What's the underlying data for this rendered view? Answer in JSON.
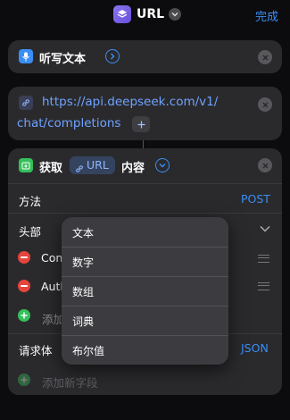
{
  "topbar": {
    "title": "URL",
    "done_label": "完成"
  },
  "dictate_action": {
    "label": "听写文本"
  },
  "url_action": {
    "url_line1": "https://api.deepseek.com/v1/",
    "url_line2": "chat/completions"
  },
  "get_contents": {
    "verb": "获取",
    "token": "URL",
    "suffix": "内容",
    "method_label": "方法",
    "method_value": "POST",
    "headers_label": "头部",
    "header1_key": "Con",
    "header2_key": "Auth",
    "add_header_label": "添加",
    "body_label": "请求体",
    "body_value": "JSON",
    "add_field_label": "添加新字段"
  },
  "type_menu": {
    "items": [
      "文本",
      "数字",
      "数组",
      "词典",
      "布尔值"
    ]
  },
  "colors": {
    "accent": "#3a8ef5",
    "delete": "#e5453c",
    "add": "#34c05a"
  }
}
